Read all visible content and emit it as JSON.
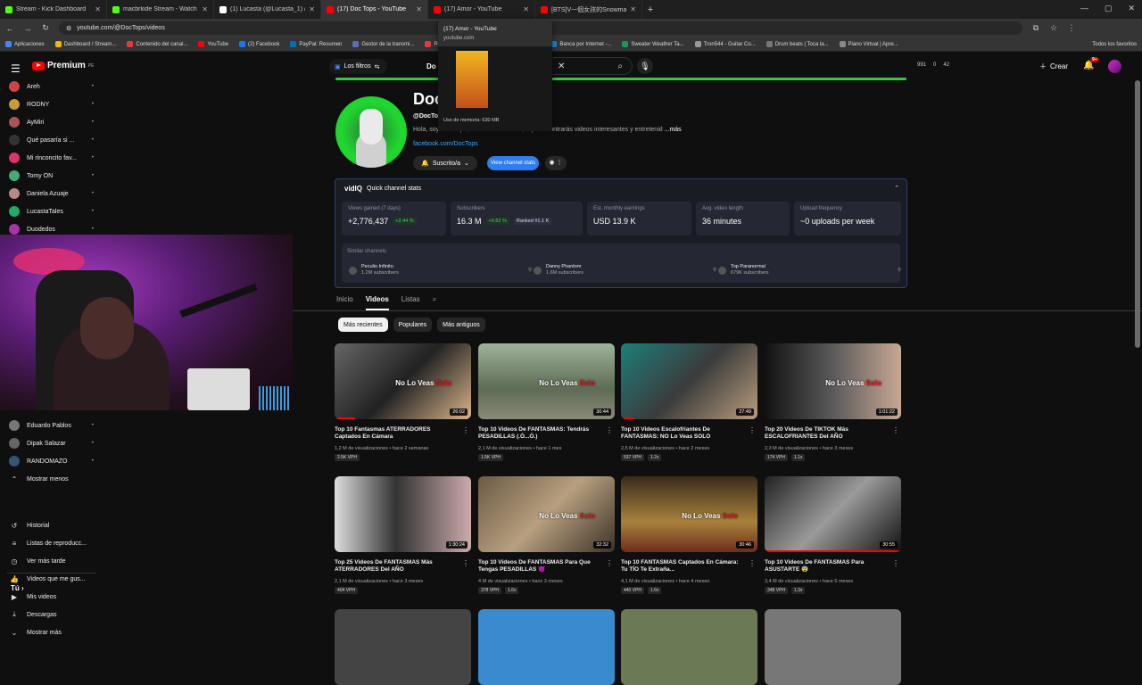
{
  "browser": {
    "tabs": [
      {
        "title": "Stream - Kick Dashboard",
        "color": "#53fc18"
      },
      {
        "title": "macbrkide Stream - Watch Live",
        "color": "#53fc18"
      },
      {
        "title": "(1) Lucasta (@Lucasta_1) / X",
        "color": "#ffffff"
      },
      {
        "title": "(17) Doc Tops - YouTube",
        "color": "#ff0000"
      },
      {
        "title": "(17) Amor - YouTube",
        "color": "#ff0000"
      },
      {
        "title": "[BTS]V一個女孩的Snowman翻",
        "color": "#ff0000"
      }
    ],
    "active_tab": 3,
    "url": "youtube.com/@DocTops/videos",
    "bookmarks": [
      "Aplicaciones",
      "Dashboard / Stream...",
      "Contenido del canal...",
      "YouTube",
      "(2) Facebook",
      "PayPal: Resumen",
      "Gestor de la transmi...",
      "Recibidos (495) - cl...",
      "Agenda | Trello",
      "Banca por Internet -...",
      "Sweater Weather Ta...",
      "Tron544 - Guitar Co...",
      "Drum beats | Toca la...",
      "Piano Virtual | Apre..."
    ],
    "bookmarks_all": "Todos los favoritos",
    "popup": {
      "title": "(17) Amor - YouTube",
      "url": "youtube.com",
      "memory": "Uso de memoria: 630 MB"
    }
  },
  "header": {
    "logo": "Premium",
    "logo_region": "PE",
    "filters_label": "Los filtros",
    "search_prefix": "Do",
    "stats": [
      "991",
      "0",
      "42"
    ],
    "create_label": "Crear",
    "notif_count": "9+"
  },
  "sidebar": {
    "subs": [
      {
        "name": "Areh",
        "color": "#c44"
      },
      {
        "name": "RODNY",
        "color": "#c93"
      },
      {
        "name": "AyMiri",
        "color": "#a55"
      },
      {
        "name": "Qué pasaría si ...",
        "color": "#333"
      },
      {
        "name": "Mi rinconcito fav...",
        "color": "#d36"
      },
      {
        "name": "Tomy ON",
        "color": "#4a7"
      },
      {
        "name": "Daniela Azuaje",
        "color": "#b88"
      },
      {
        "name": "LucastaTales",
        "color": "#2a6"
      },
      {
        "name": "Duodedos",
        "color": "#a3a"
      }
    ],
    "subs_lower": [
      {
        "name": "Eduardo Pablos",
        "color": "#777"
      },
      {
        "name": "Dipak Salazar",
        "color": "#666"
      },
      {
        "name": "RANDOMAZO",
        "color": "#357"
      }
    ],
    "show_less": "Mostrar menos",
    "you_header": "Tú",
    "you_items": [
      {
        "label": "Historial",
        "icon": "history-icon",
        "glyph": "↺"
      },
      {
        "label": "Listas de reproducc...",
        "icon": "playlist-icon",
        "glyph": "≡"
      },
      {
        "label": "Ver más tarde",
        "icon": "clock-icon",
        "glyph": "◷"
      },
      {
        "label": "Videos que me gus...",
        "icon": "thumbs-up-icon",
        "glyph": "👍"
      },
      {
        "label": "Mis videos",
        "icon": "my-videos-icon",
        "glyph": "▶"
      },
      {
        "label": "Descargas",
        "icon": "download-icon",
        "glyph": "⤓"
      },
      {
        "label": "Mostrar más",
        "icon": "chevron-down-icon",
        "glyph": "⌄"
      }
    ]
  },
  "channel": {
    "name": "Doc",
    "handle": "@DocTo",
    "description": "Hola, soy Doc Tops, bienvenido a canal, aquí encontrarás videos interesantes y entretenid",
    "more": "...más",
    "link": "facebook.com/DocTops",
    "subscribed_label": "Suscrito/a",
    "stats_button": "View channel stats"
  },
  "vidiq": {
    "logo": "vidIQ",
    "title": "Quick channel stats",
    "cards": [
      {
        "label": "Views gained (7 days)",
        "value": "+2,776,437",
        "badge": "+2.44 %",
        "badge_type": "g"
      },
      {
        "label": "Subscribers",
        "value": "16.3 M",
        "badge": "+0.62 %",
        "badge_type": "g",
        "extra": "Ranked #1.1 K"
      },
      {
        "label": "Est. monthly earnings",
        "value": "USD 13.9 K"
      },
      {
        "label": "Avg. video length",
        "value": "36 minutes"
      },
      {
        "label": "Upload frequency",
        "value": "~0 uploads per week"
      }
    ],
    "similar_label": "Similar channels",
    "similar": [
      {
        "name": "Peculio Infinito",
        "subs": "1.2M subscribers"
      },
      {
        "name": "Danny Phantom",
        "subs": "1.6M subscribers"
      },
      {
        "name": "Top Paranormal",
        "subs": "679K subscribers"
      }
    ]
  },
  "channel_tabs": [
    "Inicio",
    "Videos",
    "Listas"
  ],
  "chips": [
    "Más recientes",
    "Populares",
    "Más antiguos"
  ],
  "videos": [
    {
      "title": "Top 10 Fantasmas ATERRADORES Captados En Cámara",
      "views": "1,2 M de visualizaciones",
      "ago": "hace 2 semanas",
      "badges": [
        "2.5K VPH"
      ],
      "duration": "26:02",
      "overlay": true,
      "bg": "linear-gradient(135deg,#666,#222 50%,#d9b48a)",
      "progress": 0.15
    },
    {
      "title": "Top 10 Videos De FANTASMAS: Tendrás PESADILLAS (.Ó...Ò.)",
      "views": "2,1 M de visualizaciones",
      "ago": "hace 1 mes",
      "badges": [
        "1.5K VPH"
      ],
      "duration": "30:44",
      "overlay": true,
      "bg": "linear-gradient(180deg,#9fb39b,#5e6b55 60%,#8a8a78)",
      "progress": 0
    },
    {
      "title": "Top 10 Videos Escalofriantes De FANTASMAS: NO Lo Veas SOLO",
      "views": "2,5 M de visualizaciones",
      "ago": "hace 2 meses",
      "badges": [
        "537 VPH",
        "1.2x"
      ],
      "duration": "27:49",
      "overlay": false,
      "bg": "linear-gradient(135deg,#1c7f7a,#3b3b3b 50%,#b89d7e)",
      "progress": 0.1
    },
    {
      "title": "Top 20 Videos De TIKTOK Más ESCALOFRIANTES Del AÑO",
      "views": "2,3 M de visualizaciones",
      "ago": "hace 3 meses",
      "badges": [
        "174 VPH",
        "1.1x"
      ],
      "duration": "1:01:22",
      "overlay": true,
      "bg": "linear-gradient(90deg,#111,#5a5a5a 50%,#c7a893)",
      "progress": 0
    },
    {
      "title": "Top 25 Videos De FANTASMAS Más ATERRADORES Del AÑO",
      "views": "2,1 M de visualizaciones",
      "ago": "hace 3 meses",
      "badges": [
        "404 VPH"
      ],
      "duration": "1:30:24",
      "overlay": false,
      "bg": "linear-gradient(90deg,#ddd,#333 45%,#caa)",
      "progress": 0
    },
    {
      "title": "Top 10 Videos De FANTASMAS Para Que Tengas PESADILLAS 😈",
      "views": "4 M de visualizaciones",
      "ago": "hace 3 meses",
      "badges": [
        "378 VPH",
        "1.6x"
      ],
      "duration": "32:32",
      "overlay": true,
      "bg": "linear-gradient(135deg,#6b5a45,#b79f7f 50%,#3c3327)",
      "progress": 0
    },
    {
      "title": "Top 10 FANTASMAS Captados En Cámara: Tu TÍO Te Extraña...",
      "views": "4,1 M de visualizaciones",
      "ago": "hace 4 meses",
      "badges": [
        "440 VPH",
        "1.6x"
      ],
      "duration": "30:46",
      "overlay": true,
      "bg": "linear-gradient(180deg,#3a2a1c,#a8823c 60%,#6f2c1c)",
      "progress": 0
    },
    {
      "title": "Top 10 Videos De FANTASMAS Para ASUSTARTE 😨",
      "views": "3,4 M de visualizaciones",
      "ago": "hace 5 meses",
      "badges": [
        "348 VPH",
        "1.3x"
      ],
      "duration": "30:55",
      "overlay": false,
      "bg": "linear-gradient(135deg,#222,#9a9a9a 50%,#111)",
      "progress": 1
    }
  ],
  "overlay_text": {
    "a": "No Lo Veas ",
    "b": "Solo"
  }
}
